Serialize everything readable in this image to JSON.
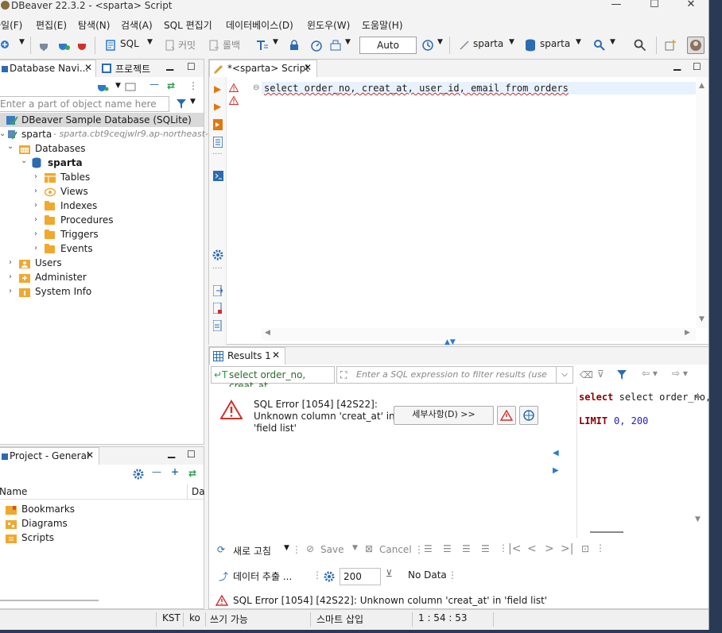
{
  "window": {
    "title": "DBeaver 22.3.2 - <sparta> Script",
    "controls": [
      "—",
      "☐",
      "✕"
    ]
  },
  "menu": [
    "파일(F)",
    "편집(E)",
    "탐색(N)",
    "검색(A)",
    "SQL 편집기",
    "데이터베이스(D)",
    "윈도우(W)",
    "도움말(H)"
  ],
  "toolbar": {
    "sql": "SQL",
    "commit": "커밋",
    "rollback": "롤백",
    "mode": "Auto",
    "connection": "sparta",
    "database": "sparta"
  },
  "navigator": {
    "tab_label": "Database Navi...",
    "project_tab": "프로젝트",
    "filter_placeholder": "Enter a part of object name here",
    "tree": {
      "sample_db": "DBeaver Sample Database (SQLite)",
      "conn_name": "sparta",
      "conn_host": "- sparta.cbt9ceqjwlr9.ap-northeast-",
      "databases": "Databases",
      "db_name": "sparta",
      "tables": "Tables",
      "views": "Views",
      "indexes": "Indexes",
      "procedures": "Procedures",
      "triggers": "Triggers",
      "events": "Events",
      "users": "Users",
      "administer": "Administer",
      "system_info": "System Info"
    }
  },
  "project": {
    "tab_label": "Project - General",
    "col_name": "Name",
    "col_data": "Da",
    "items": [
      "Bookmarks",
      "Diagrams",
      "Scripts"
    ]
  },
  "editor": {
    "tab_label": "*<sparta> Script",
    "code": "select order_no, creat_at, user_id, email from orders"
  },
  "results": {
    "tab_label": "Results 1",
    "query_preview": "select order_no, creat_at",
    "filter_placeholder": "Enter a SQL expression to filter results (use",
    "error_title": "SQL Error [1054] [42S22]:",
    "error_line2": "Unknown column 'creat_at' in",
    "error_line3": "'field list'",
    "details_button": "세부사항(D) >>",
    "sql_line1": "select order_no, crea",
    "sql_limit_kw": "LIMIT",
    "sql_limit_vals": "0, 200",
    "refresh": "새로 고침",
    "save": "Save",
    "cancel": "Cancel",
    "export": "데이터 추출 ...",
    "fetch_size": "200",
    "no_data": "No Data",
    "status_error": "SQL Error [1054] [42S22]: Unknown column 'creat_at' in 'field list'"
  },
  "statusbar": {
    "tz": "KST",
    "lang": "ko",
    "write_mode": "쓰기 가능",
    "insert_mode": "스마트 삽입",
    "position": "1 : 54 : 53"
  }
}
